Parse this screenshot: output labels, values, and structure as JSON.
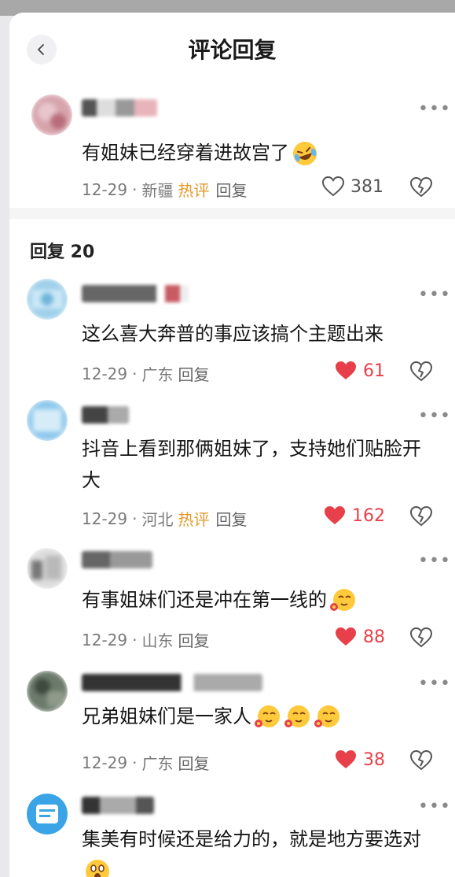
{
  "header": {
    "title": "评论回复"
  },
  "main_comment": {
    "text": "有姐妹已经穿着进故宫了",
    "date": "12-29",
    "location": "新疆",
    "hot_label": "热评",
    "reply_label": "回复",
    "likes": "381"
  },
  "replies_header": {
    "label": "回复 20"
  },
  "replies": [
    {
      "text": "这么喜大奔普的事应该搞个主题出来",
      "date": "12-29",
      "location": "广东",
      "hot_label": "",
      "reply_label": "回复",
      "likes": "61"
    },
    {
      "text": "抖音上看到那俩姐妹了，支持她们贴脸开大",
      "date": "12-29",
      "location": "河北",
      "hot_label": "热评",
      "reply_label": "回复",
      "likes": "162"
    },
    {
      "text": "有事姐妹们还是冲在第一线的",
      "date": "12-29",
      "location": "山东",
      "hot_label": "",
      "reply_label": "回复",
      "likes": "88"
    },
    {
      "text": "兄弟姐妹们是一家人",
      "date": "12-29",
      "location": "广东",
      "hot_label": "",
      "reply_label": "回复",
      "likes": "38"
    },
    {
      "text": "集美有时候还是给力的，就是地方要选对",
      "date": "",
      "location": "",
      "hot_label": "",
      "reply_label": "",
      "likes": ""
    }
  ],
  "colors": {
    "like_red": "#e8404a",
    "hot_orange": "#e39a2a"
  },
  "icons": [
    "back-chevron-icon",
    "more-icon",
    "heart-outline-icon",
    "heart-filled-icon",
    "broken-heart-icon",
    "laughing-emoji-icon",
    "flower-emoji-icon",
    "shocked-emoji-icon"
  ]
}
